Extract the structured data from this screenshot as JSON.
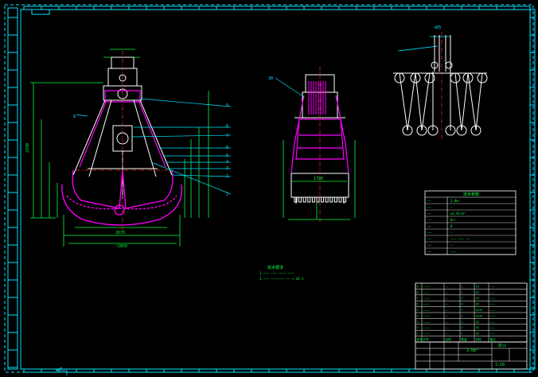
{
  "colors": {
    "background": "#000000",
    "frame": "#00e5ff",
    "grab_outline": "#ffffff",
    "grab_jaws": "#ff00ff",
    "dimensions": "#00ff40",
    "leaders": "#00e5ff",
    "centerline": "#ff3030",
    "table_text": "#00ff40"
  },
  "labels": {
    "top_view_title": "0000",
    "detail_title": "A向",
    "callout_left": "8",
    "callout_center": "30",
    "leader_numbers": [
      "9",
      "8",
      "7",
      "6",
      "5",
      "4",
      "3",
      "2",
      "1"
    ],
    "dim_left_height": "2290",
    "dim_bottom_inner": "2670",
    "dim_bottom_outer": "~2850",
    "dim_center_bottom": "1700",
    "notes_title": "技术要求",
    "notes_lines": [
      "1.——— ——— ———— ———",
      "2.——— ——————— —— × ZQ-1"
    ]
  },
  "spec_table": {
    "title": "技术参数",
    "rows": [
      {
        "key": "——",
        "value": "3.0m³"
      },
      {
        "key": "——",
        "value": "—"
      },
      {
        "key": "——",
        "value": "≤1.8t/m³"
      },
      {
        "key": "——",
        "value": "8×—"
      },
      {
        "key": "——",
        "value": "8"
      },
      {
        "key": "——",
        "value": "—"
      },
      {
        "key": "——",
        "value": "——— ——— ——"
      },
      {
        "key": "——",
        "value": "—"
      },
      {
        "key": "——",
        "value": "———"
      }
    ]
  },
  "bom_table": {
    "rows": [
      {
        "no": "9",
        "code": "————",
        "name": "——",
        "qty": "1",
        "mat": "45",
        "note": "———"
      },
      {
        "no": "8",
        "code": "————",
        "name": "——",
        "qty": "1",
        "mat": "45",
        "note": "———"
      },
      {
        "no": "7",
        "code": "————",
        "name": "——",
        "qty": "2",
        "mat": "45",
        "note": "———"
      },
      {
        "no": "6",
        "code": "————",
        "name": "——",
        "qty": "4",
        "mat": "45",
        "note": "———"
      },
      {
        "no": "5",
        "code": "————",
        "name": "——",
        "qty": "1",
        "mat": "Q235",
        "note": "———"
      },
      {
        "no": "4",
        "code": "————",
        "name": "——",
        "qty": "2",
        "mat": "Q235",
        "note": "———"
      },
      {
        "no": "3",
        "code": "————",
        "name": "——",
        "qty": "1",
        "mat": "45",
        "note": "———"
      },
      {
        "no": "2",
        "code": "————",
        "name": "——",
        "qty": "2",
        "mat": "45",
        "note": "———"
      },
      {
        "no": "1",
        "code": "————",
        "name": "——",
        "qty": "2",
        "mat": "ZG",
        "note": "———"
      }
    ],
    "header": {
      "no": "序号",
      "code": "代号",
      "name": "名称",
      "qty": "数量",
      "mat": "材料",
      "note": "备注"
    }
  },
  "title_block": {
    "drawing_name": "抓斗",
    "drawing_no": "3.0m³",
    "scale": "1:20"
  }
}
